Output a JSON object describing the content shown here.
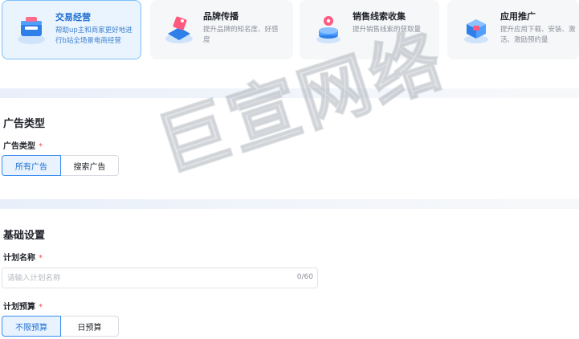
{
  "goals": [
    {
      "title": "交易经营",
      "desc_line1": "帮助up主和商家更好地进",
      "desc_line2": "行b站全场景电商经营",
      "icon": "shopping-cart-icon",
      "selected": true
    },
    {
      "title": "品牌传播",
      "desc_line1": "提升品牌的知名度、好感",
      "desc_line2": "度",
      "icon": "brand-tag-icon",
      "selected": false
    },
    {
      "title": "销售线索收集",
      "desc_line1": "提升销售线索的获取量",
      "desc_line2": "",
      "icon": "location-pin-icon",
      "selected": false
    },
    {
      "title": "应用推广",
      "desc_line1": "提升应用下载、安装、激",
      "desc_line2": "活、激励预约量",
      "icon": "app-box-icon",
      "selected": false
    }
  ],
  "ad_type": {
    "section_title": "广告类型",
    "field_label": "广告类型",
    "required_mark": "*",
    "options": [
      "所有广告",
      "搜索广告"
    ],
    "selected": "所有广告"
  },
  "basic": {
    "section_title": "基础设置",
    "plan_name_label": "计划名称",
    "plan_name_required": "*",
    "plan_name_placeholder": "请输入计划名称",
    "plan_name_count": "0/60",
    "budget_label": "计划预算",
    "budget_required": "*",
    "budget_options": [
      "不限预算",
      "日预算"
    ],
    "budget_selected": "不限预算"
  },
  "watermark": "巨宣网络",
  "colors": {
    "accent": "#1f6fd0",
    "required": "#f05454",
    "selected_bg": "#e8f3ff"
  }
}
